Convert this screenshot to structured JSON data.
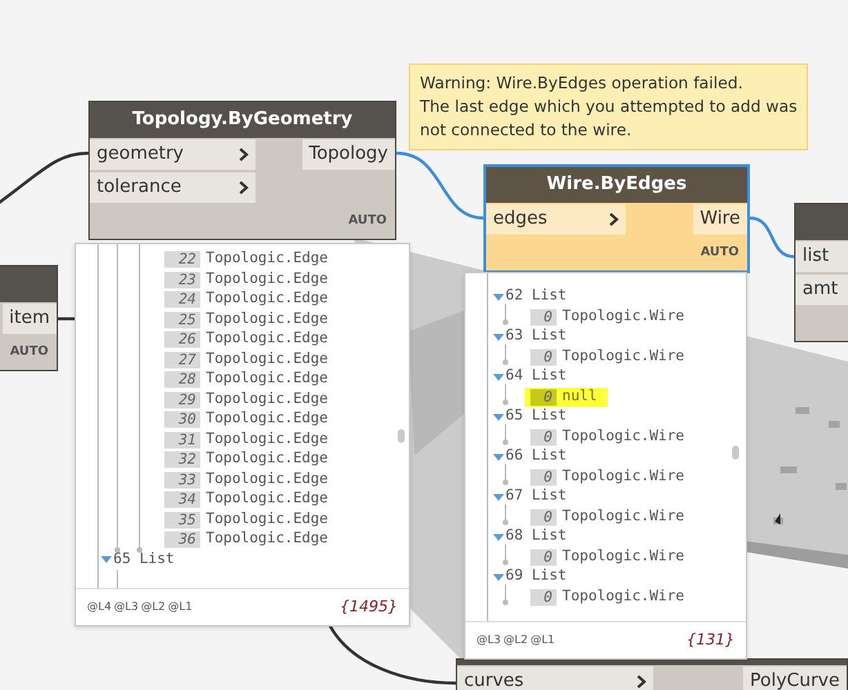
{
  "nodes": [
    {
      "outputs": [
        "item"
      ],
      "lacing": "AUTO",
      "selected": false,
      "warning": false
    },
    {
      "title": "Topology.ByGeometry",
      "inputs": [
        "geometry",
        "tolerance"
      ],
      "outputs": [
        "Topology"
      ],
      "lacing": "AUTO",
      "selected": false,
      "warning": false
    },
    {
      "title": "Wire.ByEdges",
      "inputs": [
        "edges"
      ],
      "outputs": [
        "Wire"
      ],
      "lacing": "AUTO",
      "selected": true,
      "warning": true,
      "tooltip": [
        "Warning: Wire.ByEdges operation failed.",
        "The last edge which you attempted to add was",
        "not connected to the wire."
      ]
    },
    {
      "inputs": [
        "list",
        "amt"
      ],
      "selected": false,
      "warning": false
    },
    {
      "inputs": [
        "curves"
      ],
      "outputs": [
        "PolyCurve"
      ],
      "selected": false,
      "warning": false
    }
  ],
  "previews": [
    {
      "rows": [
        {
          "kind": "item",
          "index": "22",
          "value": "Topologic.Edge",
          "highlighted": false
        },
        {
          "kind": "item",
          "index": "23",
          "value": "Topologic.Edge",
          "highlighted": false
        },
        {
          "kind": "item",
          "index": "24",
          "value": "Topologic.Edge",
          "highlighted": false
        },
        {
          "kind": "item",
          "index": "25",
          "value": "Topologic.Edge",
          "highlighted": false
        },
        {
          "kind": "item",
          "index": "26",
          "value": "Topologic.Edge",
          "highlighted": false
        },
        {
          "kind": "item",
          "index": "27",
          "value": "Topologic.Edge",
          "highlighted": false
        },
        {
          "kind": "item",
          "index": "28",
          "value": "Topologic.Edge",
          "highlighted": false
        },
        {
          "kind": "item",
          "index": "29",
          "value": "Topologic.Edge",
          "highlighted": false
        },
        {
          "kind": "item",
          "index": "30",
          "value": "Topologic.Edge",
          "highlighted": false
        },
        {
          "kind": "item",
          "index": "31",
          "value": "Topologic.Edge",
          "highlighted": false
        },
        {
          "kind": "item",
          "index": "32",
          "value": "Topologic.Edge",
          "highlighted": false
        },
        {
          "kind": "item",
          "index": "33",
          "value": "Topologic.Edge",
          "highlighted": false
        },
        {
          "kind": "item",
          "index": "34",
          "value": "Topologic.Edge",
          "highlighted": false
        },
        {
          "kind": "item",
          "index": "35",
          "value": "Topologic.Edge",
          "highlighted": false
        },
        {
          "kind": "item",
          "index": "36",
          "value": "Topologic.Edge",
          "highlighted": false
        },
        {
          "kind": "list",
          "index": "65",
          "value": "List",
          "highlighted": false
        }
      ],
      "levels": [
        "@L4",
        "@L3",
        "@L2",
        "@L1"
      ],
      "count": "{1495}"
    },
    {
      "rows": [
        {
          "kind": "list",
          "index": "62",
          "value": "List",
          "highlighted": false
        },
        {
          "kind": "item",
          "index": "0",
          "value": "Topologic.Wire",
          "highlighted": false
        },
        {
          "kind": "list",
          "index": "63",
          "value": "List",
          "highlighted": false
        },
        {
          "kind": "item",
          "index": "0",
          "value": "Topologic.Wire",
          "highlighted": false
        },
        {
          "kind": "list",
          "index": "64",
          "value": "List",
          "highlighted": false
        },
        {
          "kind": "item",
          "index": "0",
          "value": "null",
          "highlighted": true
        },
        {
          "kind": "list",
          "index": "65",
          "value": "List",
          "highlighted": false
        },
        {
          "kind": "item",
          "index": "0",
          "value": "Topologic.Wire",
          "highlighted": false
        },
        {
          "kind": "list",
          "index": "66",
          "value": "List",
          "highlighted": false
        },
        {
          "kind": "item",
          "index": "0",
          "value": "Topologic.Wire",
          "highlighted": false
        },
        {
          "kind": "list",
          "index": "67",
          "value": "List",
          "highlighted": false
        },
        {
          "kind": "item",
          "index": "0",
          "value": "Topologic.Wire",
          "highlighted": false
        },
        {
          "kind": "list",
          "index": "68",
          "value": "List",
          "highlighted": false
        },
        {
          "kind": "item",
          "index": "0",
          "value": "Topologic.Wire",
          "highlighted": false
        },
        {
          "kind": "list",
          "index": "69",
          "value": "List",
          "highlighted": false
        },
        {
          "kind": "item",
          "index": "0",
          "value": "Topologic.Wire",
          "highlighted": false
        }
      ],
      "levels": [
        "@L3",
        "@L2",
        "@L1"
      ],
      "count": "{131}"
    }
  ]
}
